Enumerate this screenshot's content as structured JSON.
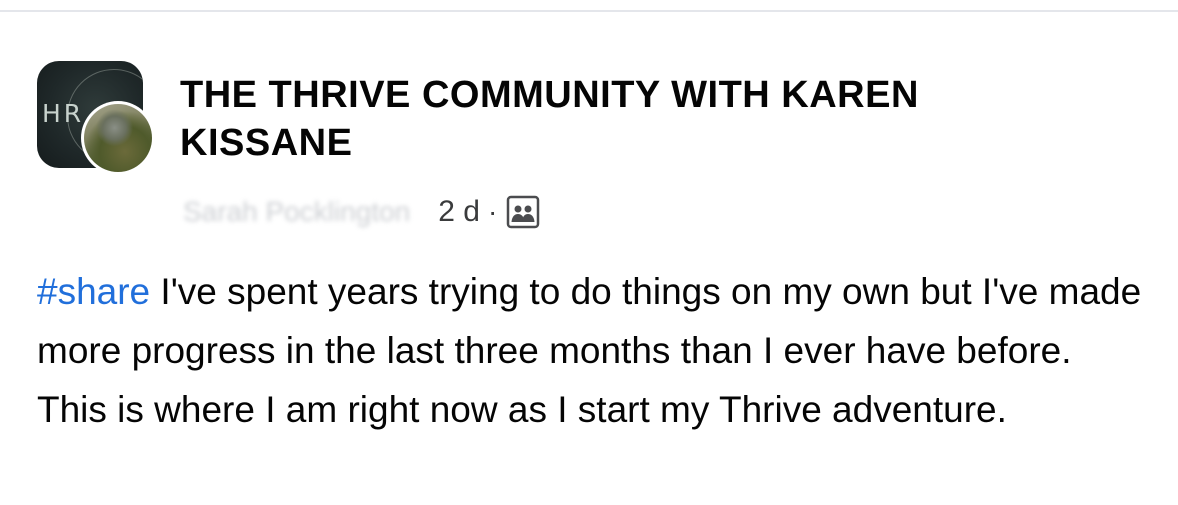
{
  "post": {
    "group_name": "THE THRIVE COMMUNITY WITH KAREN KISSANE",
    "group_logo_text": "HR",
    "author_name": "Sarah Pocklington",
    "time": "2 d",
    "separator": "·",
    "privacy_icon": "group-members-icon",
    "hashtag": "#share",
    "body_text": " I've spent years trying to do things on my own but I've made more progress in the last three months than I ever have before. This is where I am right now as I start my Thrive adventure."
  },
  "colors": {
    "hashtag": "#216fdb",
    "text": "#050505",
    "meta": "#3a3b3c",
    "divider": "#e4e6eb"
  }
}
